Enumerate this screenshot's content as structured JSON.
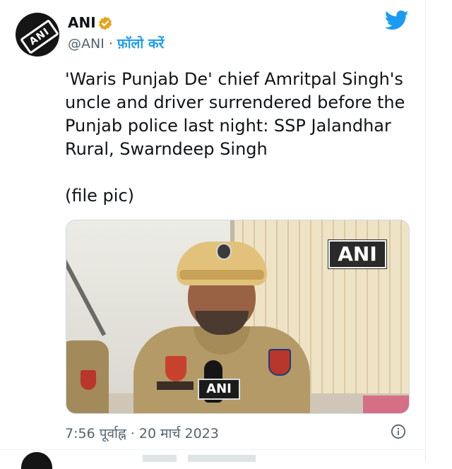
{
  "account": {
    "name": "ANI",
    "handle": "@ANI",
    "separator": " · ",
    "follow_label": "फ़ॉलो करें",
    "avatar_text": "ANI"
  },
  "tweet": {
    "text": "'Waris Punjab De' chief Amritpal Singh's\nuncle and driver surrendered before the\nPunjab police last night: SSP Jalandhar\nRural, Swarndeep Singh\n\n(file pic)",
    "timestamp": "7:56 पूर्वाह्न · 20 मार्च 2023"
  },
  "media": {
    "watermark": "ANI",
    "mic_label": "ANI"
  },
  "colors": {
    "accent": "#1d9bf0",
    "text": "#0f1419",
    "secondary": "#536471"
  },
  "icons": {
    "verified": "verified-badge-icon",
    "twitter": "twitter-bird-icon",
    "info": "info-icon"
  }
}
